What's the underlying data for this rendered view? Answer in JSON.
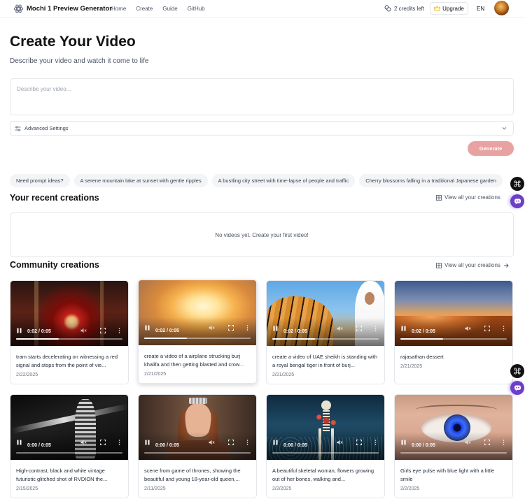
{
  "header": {
    "brand": "Mochi 1 Preview Generator",
    "nav": [
      "Home",
      "Create",
      "Guide",
      "GitHub"
    ],
    "credits": "2 credits left",
    "upgrade": "Upgrade",
    "lang": "EN"
  },
  "hero": {
    "title": "Create Your Video",
    "subtitle": "Describe your video and watch it come to life",
    "placeholder": "Describe your video...",
    "advanced": "Advanced Settings",
    "generate": "Generate"
  },
  "chips": [
    "Need prompt ideas?",
    "A serene mountain lake at sunset with gentle ripples",
    "A bustling city street with time-lapse of people and traffic",
    "Cherry blossoms falling in a traditional Japanese garden"
  ],
  "recent": {
    "title": "Your recent creations",
    "view_all": "View all your creations",
    "empty": "No videos yet. Create your first video!"
  },
  "community": {
    "title": "Community creations",
    "view_all": "View all your creations",
    "cards": [
      {
        "time": "0:02 / 0:05",
        "progress": 0.4,
        "caption": "tram starts decelerating on witnessing a red signal and stops from the point of vie...",
        "date": "2/22/2025"
      },
      {
        "time": "0:02 / 0:05",
        "progress": 0.4,
        "caption": "create a video of a airplane strucking burj khalifa and then getting blasted and crow...",
        "date": "2/21/2025"
      },
      {
        "time": "0:02 / 0:05",
        "progress": 0.4,
        "caption": "create a video of UAE sheikh is standing with a royal bengal tiger in front of burj...",
        "date": "2/21/2025"
      },
      {
        "time": "0:02 / 0:05",
        "progress": 0.4,
        "caption": "rajasathan dessert",
        "date": "2/21/2025"
      },
      {
        "time": "0:00 / 0:05",
        "progress": 0.0,
        "caption": "High-contrast, black and white vintage futuristic glitched shot of RVDION the...",
        "date": "2/15/2025"
      },
      {
        "time": "0:00 / 0:05",
        "progress": 0.0,
        "caption": "scene from game of thrones, showing the beautiful and young 18-year-old queen,...",
        "date": "2/11/2025"
      },
      {
        "time": "0:00 / 0:05",
        "progress": 0.0,
        "caption": "A beautiful skeletal woman, flowers growing out of her bones, walking and...",
        "date": "2/2/2025"
      },
      {
        "time": "0:00 / 0:05",
        "progress": 0.0,
        "caption": "Girls eye pulse with blue light with a little smile",
        "date": "2/2/2025"
      }
    ]
  },
  "colors": {
    "generate_bg": "#e8a2a2",
    "upgrade_crown": "#f5b400",
    "float_purple": "#6d3fc9"
  },
  "icons": [
    "logo-icon",
    "credits-icon",
    "crown-icon",
    "settings-sliders-icon",
    "chevron-down-icon",
    "grid-icon",
    "arrow-right-icon",
    "pause-icon",
    "mute-icon",
    "fullscreen-icon",
    "more-vertical-icon",
    "command-icon",
    "chat-bot-icon"
  ]
}
